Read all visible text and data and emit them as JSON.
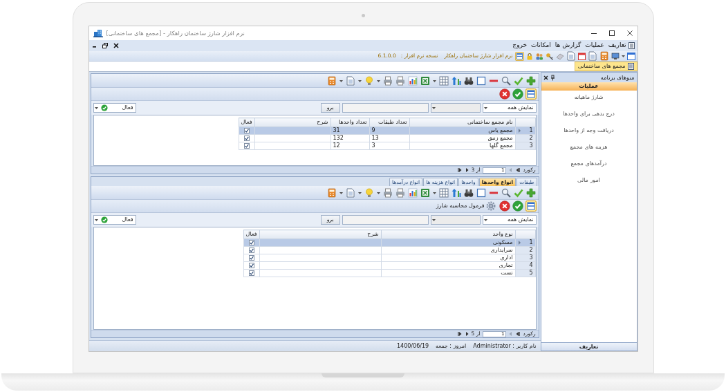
{
  "window": {
    "title": "نرم افزار شارژ ساختمان راهکار - [مجمع های ساختمانی]"
  },
  "menu": [
    {
      "label": "تعاریف"
    },
    {
      "label": "عملیات"
    },
    {
      "label": "گزارش ها"
    },
    {
      "label": "امکانات"
    },
    {
      "label": "خروج"
    }
  ],
  "info_bar": {
    "app_name": "نرم افزار شارژ ساختمان راهکار",
    "version_label": "نسخه نرم افزار :",
    "version": "6.1.0.0"
  },
  "document_tabs": [
    {
      "label": "مجمع های ساختمانی",
      "selected": true
    }
  ],
  "complexes": {
    "filter": {
      "show": "نمایش همه",
      "go": "برو",
      "status": "فعال"
    },
    "columns": [
      "نام مجمع ساختمانی",
      "تعداد طبقات",
      "تعداد واحدها",
      "شرح",
      "فعال"
    ],
    "rows": [
      {
        "number": "1",
        "cells": [
          "مجمع یاس",
          "9",
          "31"
        ],
        "active": true,
        "selected": true
      },
      {
        "number": "2",
        "cells": [
          "مجمع زنبق",
          "13",
          "132"
        ],
        "active": true,
        "selected": false
      },
      {
        "number": "3",
        "cells": [
          "مجمع گلها",
          "3",
          "12"
        ],
        "active": true,
        "selected": false
      }
    ],
    "pager": {
      "label": "رکورد",
      "current": "1",
      "total": "از 3"
    }
  },
  "details": {
    "tabs": [
      {
        "label": "طبقات",
        "selected": false
      },
      {
        "label": "انواع واحدها",
        "selected": true
      },
      {
        "label": "واحدها",
        "selected": false
      },
      {
        "label": "انواع هزینه ها",
        "selected": false
      },
      {
        "label": "انواع درآمدها",
        "selected": false
      }
    ],
    "action": "فرمول محاسبه شارژ",
    "filter": {
      "show": "نمایش همه",
      "go": "برو",
      "status": "فعال"
    },
    "columns": [
      "نوع واحد",
      "شرح",
      "فعال"
    ],
    "rows": [
      {
        "number": "1",
        "cells": [
          "مسکونی"
        ],
        "active": true,
        "selected": true
      },
      {
        "number": "2",
        "cells": [
          "سرایداری"
        ],
        "active": true,
        "selected": false
      },
      {
        "number": "3",
        "cells": [
          "اداری"
        ],
        "active": true,
        "selected": false
      },
      {
        "number": "4",
        "cells": [
          "تجاری"
        ],
        "active": true,
        "selected": false
      },
      {
        "number": "5",
        "cells": [
          "تست"
        ],
        "active": true,
        "selected": false
      }
    ],
    "pager": {
      "label": "رکورد",
      "current": "1",
      "total": "از 5"
    }
  },
  "status_bar": {
    "user": "نام کاربر : Administrator",
    "today": "امروز : جمعه",
    "date": "1400/06/19"
  },
  "sidebar": {
    "title": "منوهای برنامه",
    "sections": [
      {
        "label": "عملیات",
        "expanded": true,
        "items": [
          {
            "label": "شارژ ماهیانه"
          },
          {
            "label": "درج بدهی برای واحدها"
          },
          {
            "label": "دریافت وجه از واحدها"
          },
          {
            "label": "هزینه های مجمع"
          },
          {
            "label": "درآمدهای مجمع"
          },
          {
            "label": "امور مالی"
          }
        ]
      },
      {
        "label": "تعاریف",
        "expanded": false
      }
    ]
  }
}
